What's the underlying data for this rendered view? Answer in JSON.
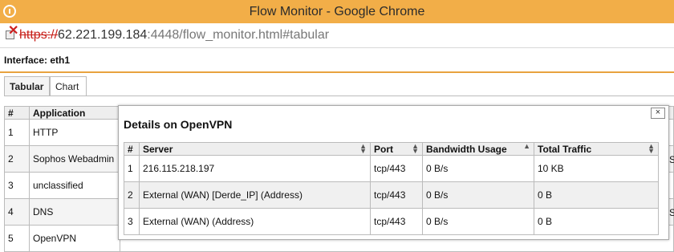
{
  "window": {
    "title": "Flow Monitor - Google Chrome"
  },
  "address": {
    "scheme": "https://",
    "host": "62.221.199.184",
    "port_path": ":4448/flow_monitor.html#tabular"
  },
  "interface": {
    "label": "Interface: eth1"
  },
  "tabs": [
    {
      "label": "Tabular",
      "active": true
    },
    {
      "label": "Chart",
      "active": false
    }
  ],
  "bg_table": {
    "headers": [
      "#",
      "Application"
    ],
    "rows": [
      [
        "1",
        "HTTP"
      ],
      [
        "2",
        "Sophos Webadmin"
      ],
      [
        "3",
        "unclassified"
      ],
      [
        "4",
        "DNS"
      ],
      [
        "5",
        "OpenVPN"
      ]
    ],
    "right_edge_text": "S"
  },
  "modal": {
    "title": "Details on OpenVPN",
    "close_label": "×",
    "headers": [
      "#",
      "Server",
      "Port",
      "Bandwidth Usage",
      "Total Traffic"
    ],
    "rows": [
      [
        "1",
        "216.115.218.197",
        "tcp/443",
        "0 B/s",
        "10 KB"
      ],
      [
        "2",
        "External (WAN) [Derde_IP] (Address)",
        "tcp/443",
        "0 B/s",
        "0 B"
      ],
      [
        "3",
        "External (WAN) (Address)",
        "tcp/443",
        "0 B/s",
        "0 B"
      ]
    ]
  },
  "colors": {
    "titlebar": "#f2ae48",
    "accent_line": "#e8a33f",
    "insecure_scheme": "#c8211b"
  }
}
